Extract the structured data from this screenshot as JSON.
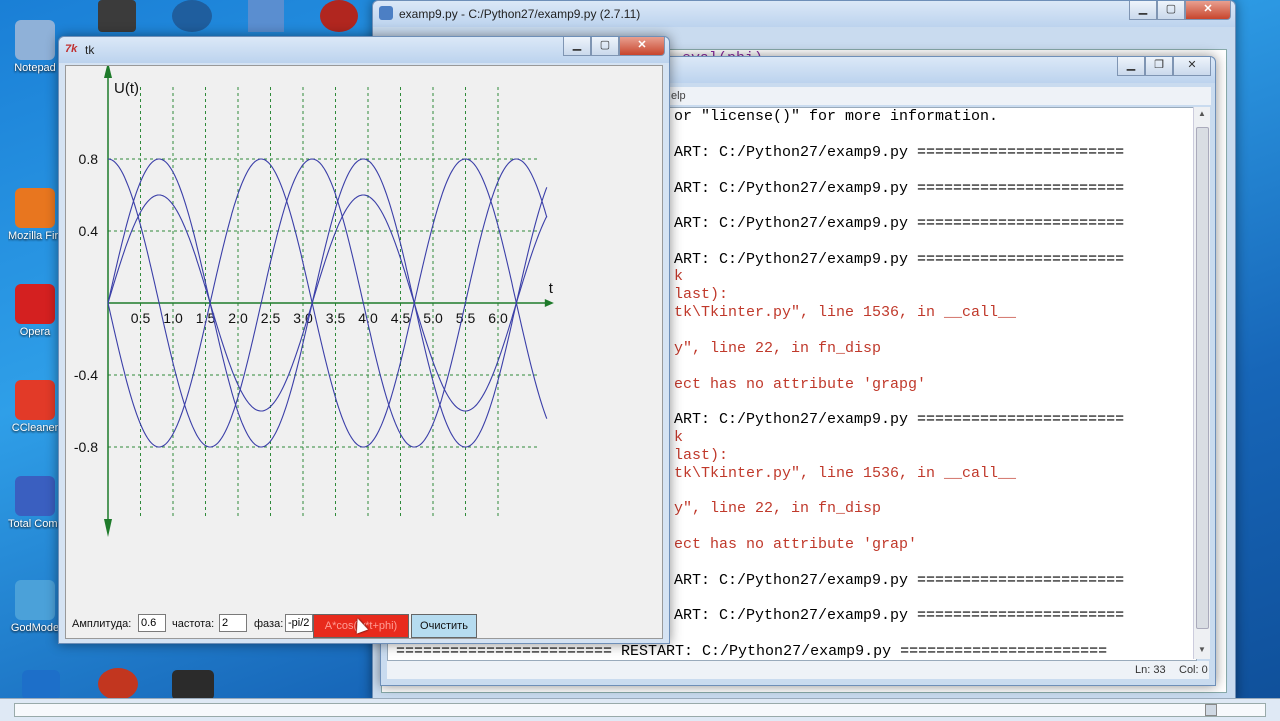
{
  "desktop": {
    "icons": [
      {
        "label": "Notepad",
        "color": "#8fb1d8"
      },
      {
        "label": "Mozilla Firefox",
        "color": "#e8761f"
      },
      {
        "label": "Opera",
        "color": "#d42020"
      },
      {
        "label": "CCleaner",
        "color": "#e23a28"
      },
      {
        "label": "Total Commander",
        "color": "#3a5fc0"
      },
      {
        "label": "GodMode",
        "color": "#4ba1d9"
      }
    ]
  },
  "editor_window": {
    "title": "examp9.py - C:/Python27/examp9.py (2.7.11)",
    "code_fragment": "eval(phi)"
  },
  "shell_window": {
    "menu_fragment": "elp",
    "lines": [
      {
        "text": "or \"license()\" for more information.",
        "color": "black"
      },
      {
        "text": "ART: C:/Python27/examp9.py =======================",
        "color": "black"
      },
      {
        "text": "ART: C:/Python27/examp9.py =======================",
        "color": "black"
      },
      {
        "text": "ART: C:/Python27/examp9.py =======================",
        "color": "black"
      },
      {
        "text": "ART: C:/Python27/examp9.py =======================",
        "color": "black"
      },
      {
        "text": "k",
        "color": "red"
      },
      {
        "text": "last):",
        "color": "red"
      },
      {
        "text": "tk\\Tkinter.py\", line 1536, in __call__",
        "color": "red"
      },
      {
        "text": "y\", line 22, in fn_disp",
        "color": "red"
      },
      {
        "text": "ect has no attribute 'grapg'",
        "color": "red"
      },
      {
        "text": "ART: C:/Python27/examp9.py =======================",
        "color": "black"
      },
      {
        "text": "k",
        "color": "red"
      },
      {
        "text": "last):",
        "color": "red"
      },
      {
        "text": "tk\\Tkinter.py\", line 1536, in __call__",
        "color": "red"
      },
      {
        "text": "y\", line 22, in fn_disp",
        "color": "red"
      },
      {
        "text": "ect has no attribute 'grap'",
        "color": "red"
      },
      {
        "text": "ART: C:/Python27/examp9.py =======================",
        "color": "black"
      },
      {
        "text": "ART: C:/Python27/examp9.py =======================",
        "color": "black"
      },
      {
        "text": "======================== RESTART: C:/Python27/examp9.py =======================",
        "color": "black"
      }
    ],
    "status": {
      "ln": "Ln: 33",
      "col": "Col: 0"
    }
  },
  "tk_window": {
    "title": "tk",
    "controls": {
      "amplitude_label": "Амплитуда:",
      "amplitude_value": "0.6",
      "frequency_label": "частота:",
      "frequency_value": "2",
      "phase_label": "фаза:",
      "phase_value": "-pi/2",
      "draw_button": "A*cos(w*t+phi)",
      "clear_button": "Очистить"
    }
  },
  "chart_data": {
    "type": "line",
    "ylabel": "U(t)",
    "xlabel": "t",
    "xlim": [
      0,
      6.5
    ],
    "ylim": [
      -1.2,
      1.2
    ],
    "x_ticks": [
      0.5,
      1.0,
      1.5,
      2.0,
      2.5,
      3.0,
      3.5,
      4.0,
      4.5,
      5.0,
      5.5,
      6.0
    ],
    "x_tick_labels": [
      "0.5",
      "1.0",
      "1.5",
      "2.0",
      "2.5",
      "3.0",
      "3.5",
      "4.0",
      "4.5",
      "5.0",
      "5.5",
      "6.0"
    ],
    "y_ticks": [
      0.8,
      0.4,
      -0.4,
      -0.8
    ],
    "y_tick_labels": [
      "0.8",
      "0.4",
      "-0.4",
      "-0.8"
    ],
    "grid": true,
    "series": [
      {
        "amplitude": 0.8,
        "omega": 2,
        "phi": 0
      },
      {
        "amplitude": 0.6,
        "omega": 2,
        "phi": -1.5708
      },
      {
        "amplitude": 0.8,
        "omega": 2,
        "phi": -1.5708
      },
      {
        "amplitude": 0.8,
        "omega": 2,
        "phi": 1.5708
      }
    ],
    "line_color": "#3b3fa8",
    "axis_color": "#1e7a2a",
    "grid_color": "#2f8a3a"
  },
  "taskbar": {
    "color": "#dfe9f5"
  }
}
